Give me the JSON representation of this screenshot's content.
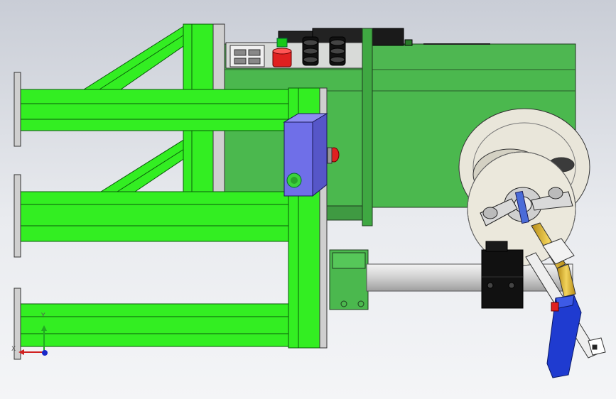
{
  "axis_triad": {
    "x_label": "X",
    "y_label": "Y"
  },
  "colors": {
    "frame_green": "#33ee22",
    "body_green": "#4bb84e",
    "junction_box": "#6f6fe8",
    "tube_grey": "#dcdcdc",
    "spool": "#e9e6da",
    "torch_gold": "#e6c440",
    "handle_blue": "#1f3bd0",
    "stop_red": "#e02020"
  },
  "icons": [
    "emergency-stop-icon",
    "indicator-light-icon",
    "axis-triad-icon"
  ]
}
